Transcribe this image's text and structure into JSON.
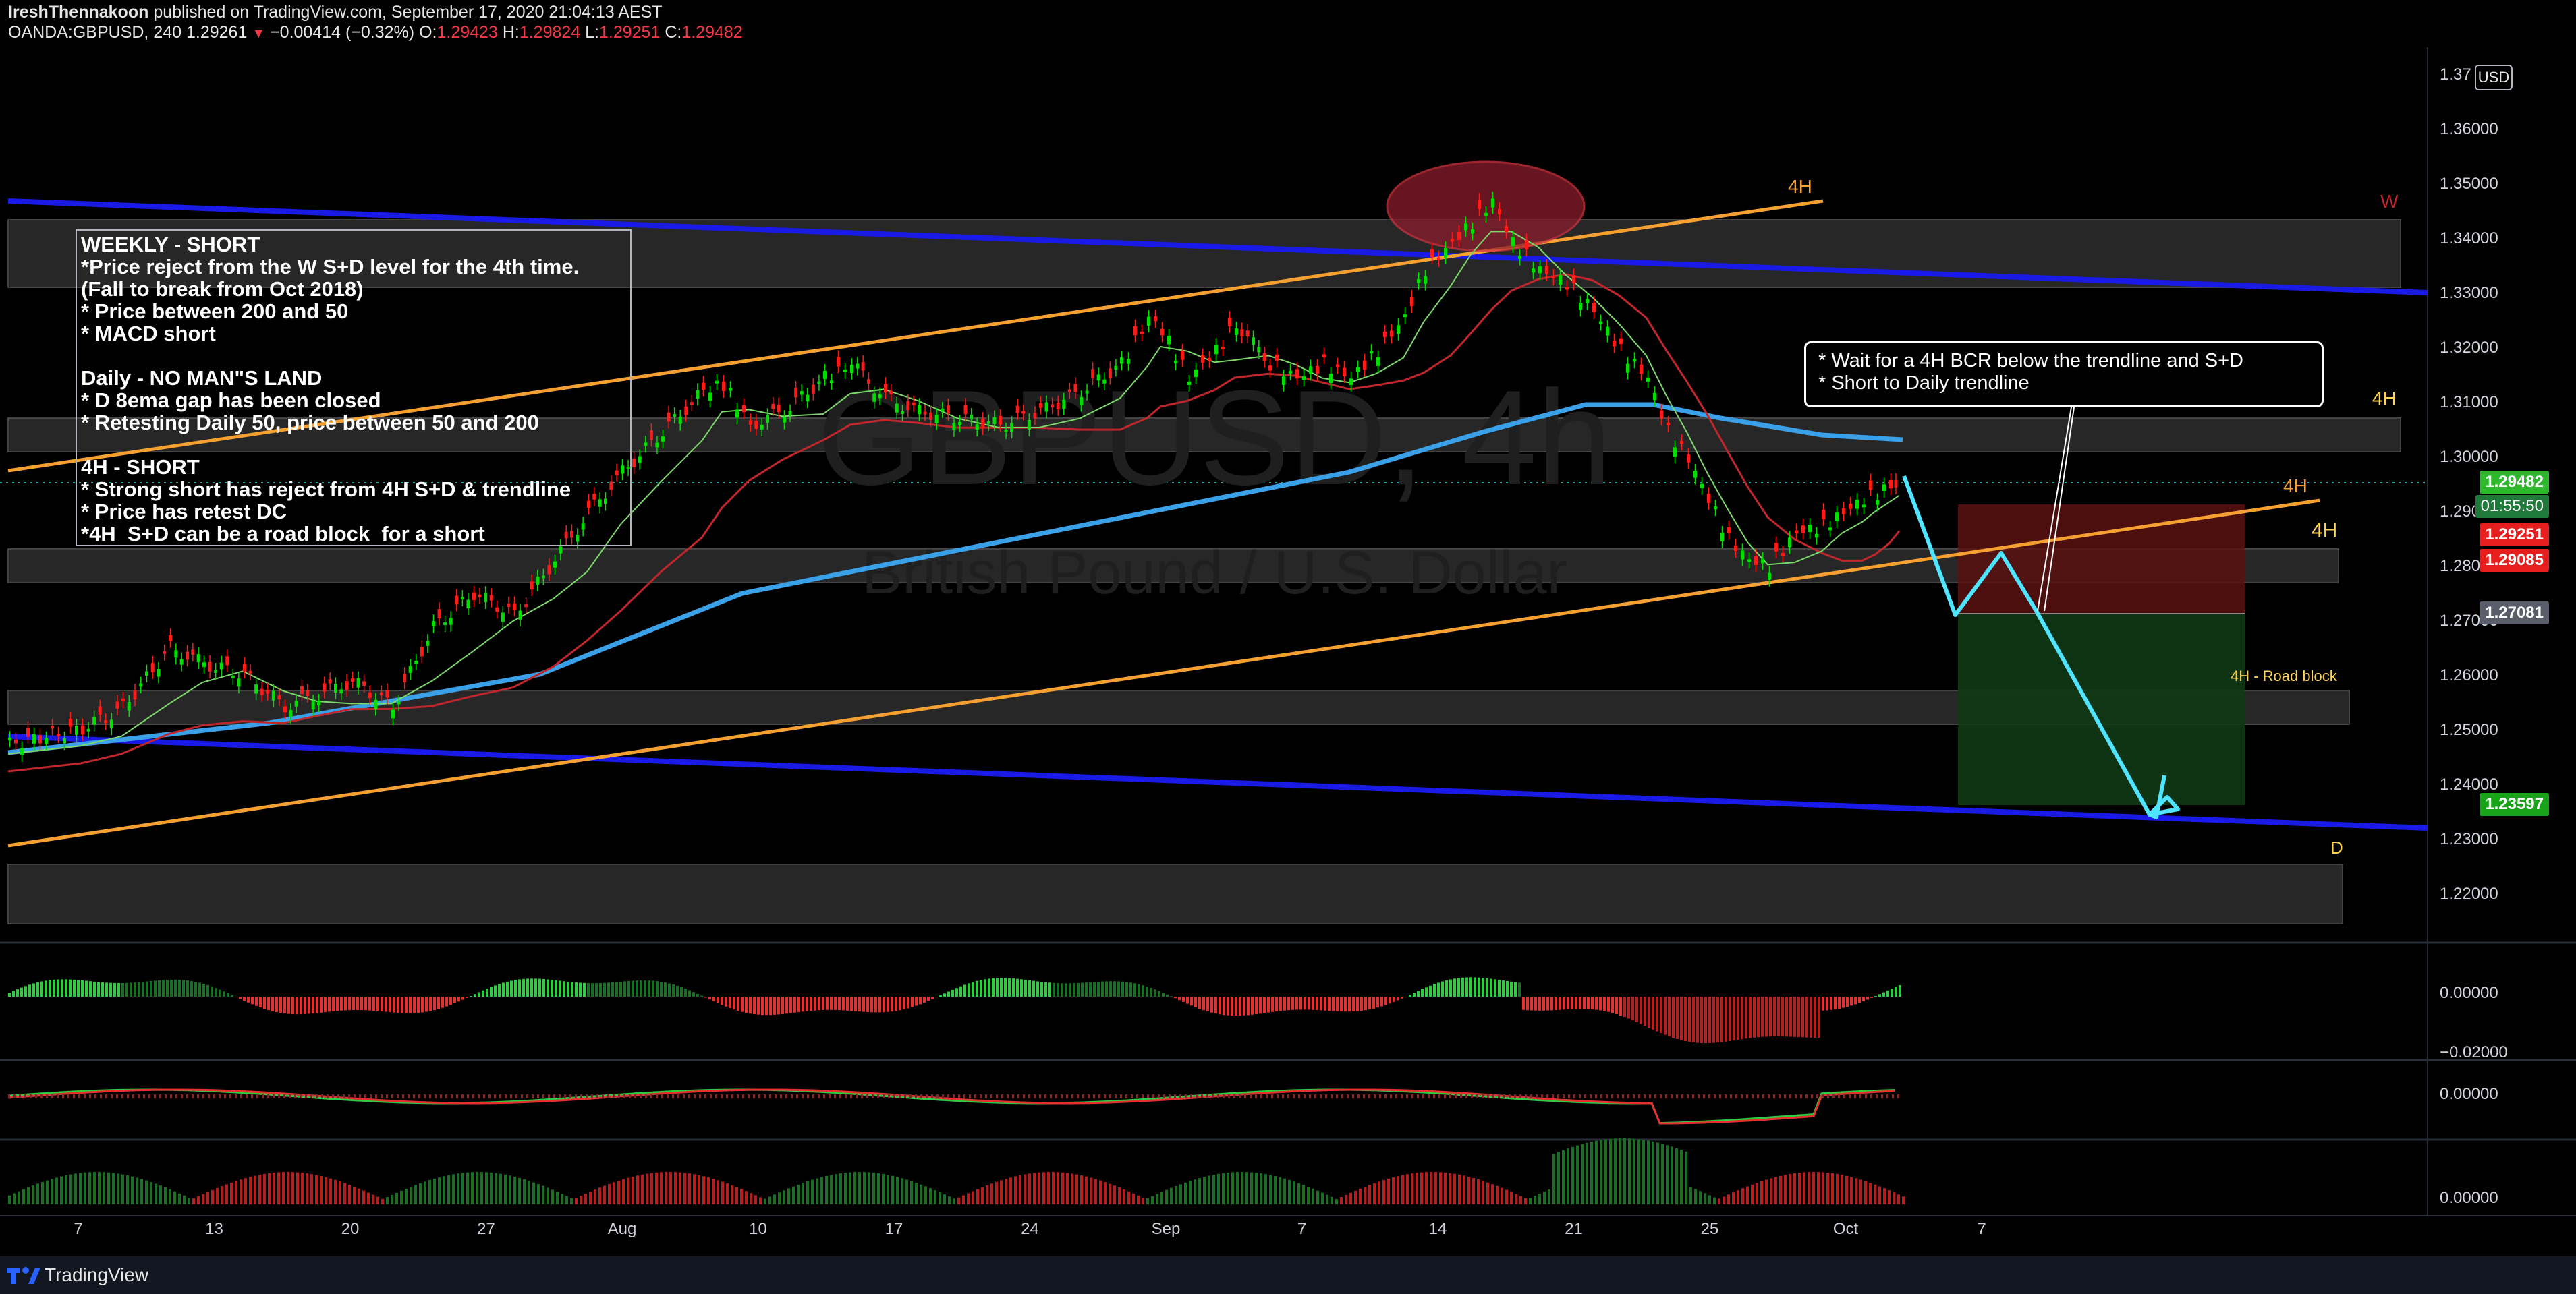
{
  "header": {
    "author": "IreshThennakoon",
    "published": "published on TradingView.com, September 17, 2020 21:04:13 AEST",
    "symbol": "OANDA:GBPUSD, 240",
    "last": "1.29261",
    "change": "−0.00414 (−0.32%)",
    "o_label": "O:",
    "o_val": "1.29423",
    "h_label": "H:",
    "h_val": "1.29824",
    "l_label": "L:",
    "l_val": "1.29251",
    "c_label": "C:",
    "c_val": "1.29482"
  },
  "watermark": {
    "symbol": "GBPUSD, 4h",
    "name": "British Pound / U.S. Dollar"
  },
  "price_axis": {
    "currency": "USD",
    "ticks": [
      "1.37",
      "1.36000",
      "1.35000",
      "1.34000",
      "1.33000",
      "1.32000",
      "1.31000",
      "1.30000",
      "1.29000",
      "1.28000",
      "1.27000",
      "1.26000",
      "1.25000",
      "1.24000",
      "1.23000",
      "1.22000"
    ],
    "labels": {
      "current_price": "1.29482",
      "countdown": "01:55:50",
      "low_marker": "1.29251",
      "level_a": "1.29085",
      "target_entry": "1.27081",
      "target_tp": "1.23597"
    }
  },
  "indicator_axis": {
    "macd_ticks": [
      "0.00000",
      "−0.02000"
    ],
    "rsi_ticks": [
      "0.00000"
    ],
    "vol_ticks": [
      "0.00000"
    ]
  },
  "time_axis": [
    "7",
    "13",
    "20",
    "27",
    "Aug",
    "10",
    "17",
    "24",
    "Sep",
    "7",
    "14",
    "21",
    "25",
    "Oct",
    "7"
  ],
  "annotations": {
    "weekly_note": "WEEKLY - SHORT\n*Price reject from the W S+D level for the 4th time.\n(Fall to break from Oct 2018)\n* Price between 200 and 50\n* MACD short\n\nDaily - NO MAN\"S LAND\n* D 8ema gap has been closed\n* Retesting Daily 50, price between 50 and 200\n\n4H - SHORT\n* Strong short has reject from 4H S+D & trendline\n* Price has retest DC\n*4H  S+D can be a road block  for a short",
    "plan_note": "* Wait for a 4H BCR below the trendline and S+D\n* Short to Daily trendline",
    "tag_4h_top": "4H",
    "tag_w": "W",
    "tag_4h_right": "4H",
    "tag_4h_orange": "4H",
    "tag_4h_mid": "4H",
    "tag_roadblock": "4H - Road block",
    "tag_d": "D"
  },
  "colors": {
    "up": "#00e000",
    "down": "#ff1a1a",
    "ema200": "#3aa0e8",
    "ema50": "#c0272d",
    "ema_fast": "#7cd86a",
    "trend_blue": "#1a1ae6",
    "trend_orange": "#f5a030",
    "projection": "#4fe4ff",
    "zone": "#2a2a2a"
  },
  "footer": {
    "brand": "TradingView"
  }
}
